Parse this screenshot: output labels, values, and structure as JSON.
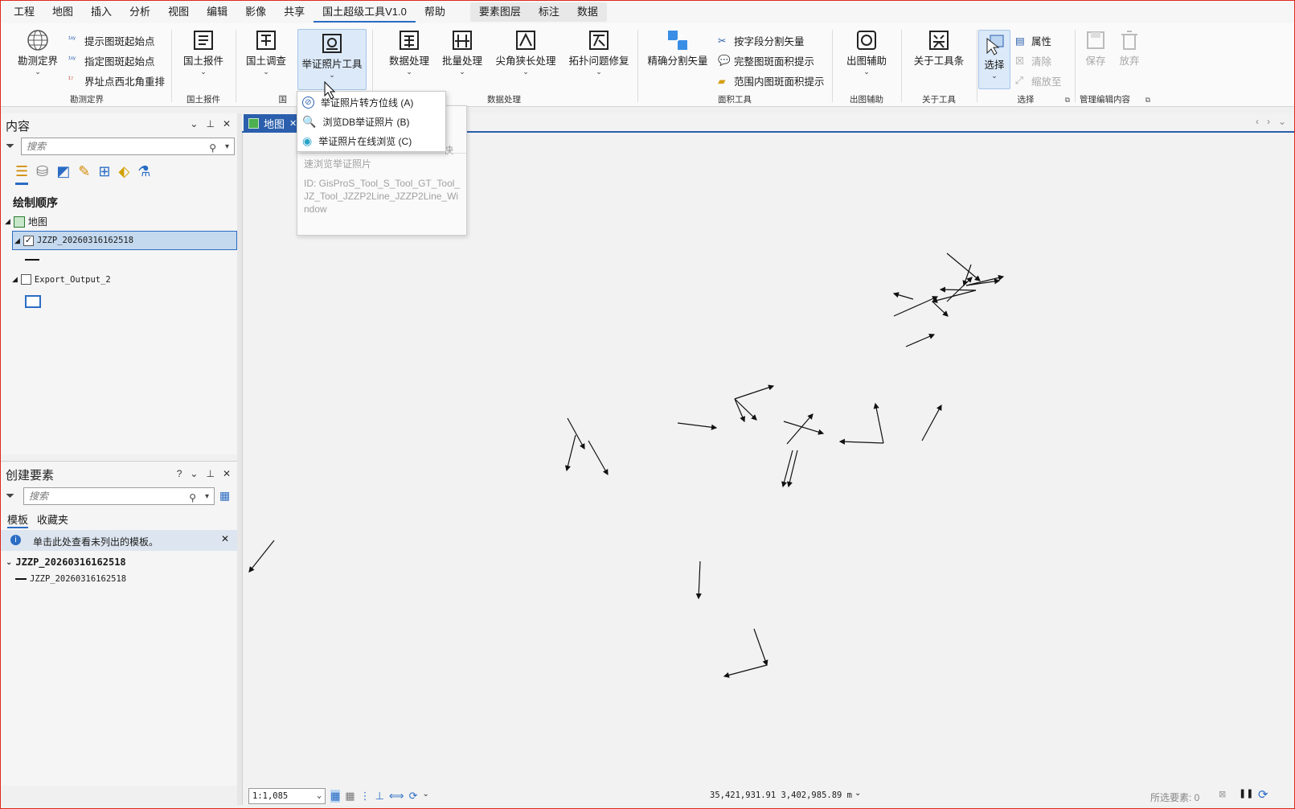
{
  "menubar": {
    "items": [
      "工程",
      "地图",
      "插入",
      "分析",
      "视图",
      "编辑",
      "影像",
      "共享",
      "国土超级工具V1.0",
      "帮助"
    ],
    "context": [
      "要素图层",
      "标注",
      "数据"
    ]
  },
  "ribbon": {
    "g1": {
      "label": "勘测定界",
      "big": "勘测定界",
      "small": [
        "提示图斑起始点",
        "指定图斑起始点",
        "界址点西北角重排"
      ]
    },
    "g2": {
      "label": "国土报件",
      "big": "国土报件"
    },
    "g3": {
      "label": "国",
      "big": "国土调查"
    },
    "g4": {
      "big": "举证照片工具"
    },
    "g5": {
      "label": "数据处理",
      "buttons": [
        "数据处理",
        "批量处理",
        "尖角狭长处理",
        "拓扑问题修复"
      ]
    },
    "g6": {
      "label": "面积工具",
      "big": "精确分割矢量",
      "small": [
        "按字段分割矢量",
        "完整图斑面积提示",
        "范围内图斑面积提示"
      ]
    },
    "g7": {
      "label": "出图辅助",
      "big": "出图辅助"
    },
    "g8": {
      "label": "关于工具",
      "big": "关于工具条"
    },
    "g9": {
      "label": "选择",
      "big": "选择",
      "small": [
        "属性",
        "清除",
        "缩放至"
      ]
    },
    "g10": {
      "label": "管理编辑内容",
      "buttons": [
        "保存",
        "放弃"
      ]
    }
  },
  "dropdown": {
    "items": [
      "举证照片转方位线 (A)",
      "浏览DB举证照片 (B)",
      "举证照片在线浏览 (C)"
    ],
    "tooltip": {
      "partial": "快",
      "line": "速浏览举证照片",
      "id": "ID: GisProS_Tool_S_Tool_GT_Tool_JZ_Tool_JZZP2Line_JZZP2Line_Window"
    }
  },
  "contents": {
    "title": "内容",
    "search_placeholder": "搜索",
    "draw_order": "绘制顺序",
    "map": "地图",
    "layer1": "JZZP_20260316162518",
    "layer2": "Export_Output_2"
  },
  "create": {
    "title": "创建要素",
    "search_placeholder": "搜索",
    "tabs": [
      "模板",
      "收藏夹"
    ],
    "info": "单击此处查看未列出的模板。",
    "group": "JZZP_20260316162518",
    "item": "JZZP_20260316162518"
  },
  "map": {
    "tab": "地图",
    "scale": "1:1,085",
    "coords": "35,421,931.91 3,402,985.89 m",
    "selected": "所选要素: 0"
  },
  "colors": {
    "accent": "#2b5fad",
    "highlight": "#dbe9f8"
  }
}
